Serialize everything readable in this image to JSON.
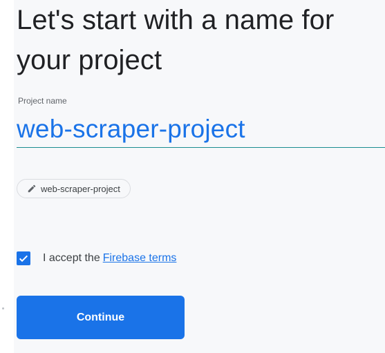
{
  "heading": "Let's start with a name for your project",
  "project_name": {
    "label": "Project name",
    "value": "web-scraper-project"
  },
  "project_id_chip": {
    "icon": "pencil-icon",
    "text": "web-scraper-project"
  },
  "terms": {
    "checked": true,
    "text": "I accept the",
    "link_text": "Firebase terms"
  },
  "continue_label": "Continue",
  "colors": {
    "accent": "#1a73e8",
    "underline": "#1a8c8f",
    "background": "#f7f8fa",
    "text": "#202124"
  }
}
